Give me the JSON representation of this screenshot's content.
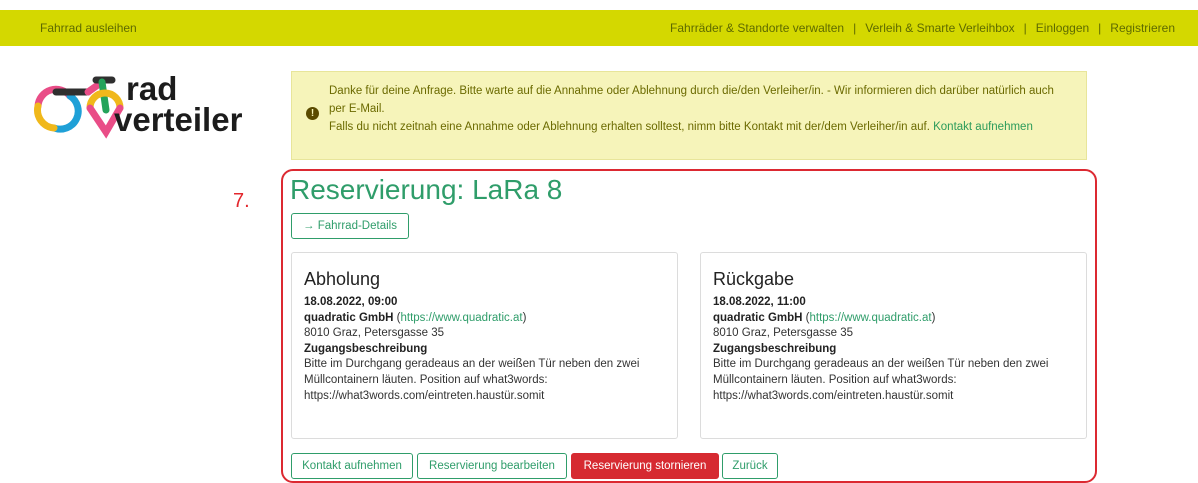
{
  "nav": {
    "left_link": "Fahrrad ausleihen",
    "right_links": [
      "Fahrräder & Standorte verwalten",
      "Verleih & Smarte Verleihbox",
      "Einloggen",
      "Registrieren"
    ],
    "separator": "|"
  },
  "logo": {
    "alt": "radverteiler",
    "text_top": "rad",
    "text_bottom": "verteiler"
  },
  "alert": {
    "line1": "Danke für deine Anfrage. Bitte warte auf die Annahme oder Ablehnung durch die/den Verleiher/in. - Wir informieren dich darüber natürlich auch per E-Mail.",
    "line2": "Falls du nicht zeitnah eine Annahme oder Ablehnung erhalten solltest, nimm bitte Kontakt mit der/dem Verleiher/in auf.",
    "contact_link": "Kontakt aufnehmen",
    "icon": "exclamation-circle-icon"
  },
  "step_marker": "7.",
  "reservation": {
    "title": "Reservierung: LaRa 8",
    "details_button": "→ Fahrrad-Details",
    "pickup": {
      "heading": "Abholung",
      "datetime": "18.08.2022, 09:00",
      "company": "quadratic GmbH",
      "url": "https://www.quadratic.at",
      "address": "8010 Graz, Petersgasse 35",
      "access_heading": "Zugangsbeschreibung",
      "access_text": "Bitte im Durchgang geradeaus an der weißen Tür neben den zwei Müllcontainern läuten. Position auf what3words: https://what3words.com/eintreten.haustür.somit"
    },
    "return": {
      "heading": "Rückgabe",
      "datetime": "18.08.2022, 11:00",
      "company": "quadratic GmbH",
      "url": "https://www.quadratic.at",
      "address": "8010 Graz, Petersgasse 35",
      "access_heading": "Zugangsbeschreibung",
      "access_text": "Bitte im Durchgang geradeaus an der weißen Tür neben den zwei Müllcontainern läuten. Position auf what3words: https://what3words.com/eintreten.haustür.somit"
    },
    "actions": {
      "contact": "Kontakt aufnehmen",
      "edit": "Reservierung bearbeiten",
      "cancel": "Reservierung stornieren",
      "back": "Zurück"
    }
  },
  "colors": {
    "nav_bg": "#d4d800",
    "accent_green": "#2f9d6a",
    "danger_red": "#d62a31",
    "alert_bg": "#f6f4ba"
  }
}
